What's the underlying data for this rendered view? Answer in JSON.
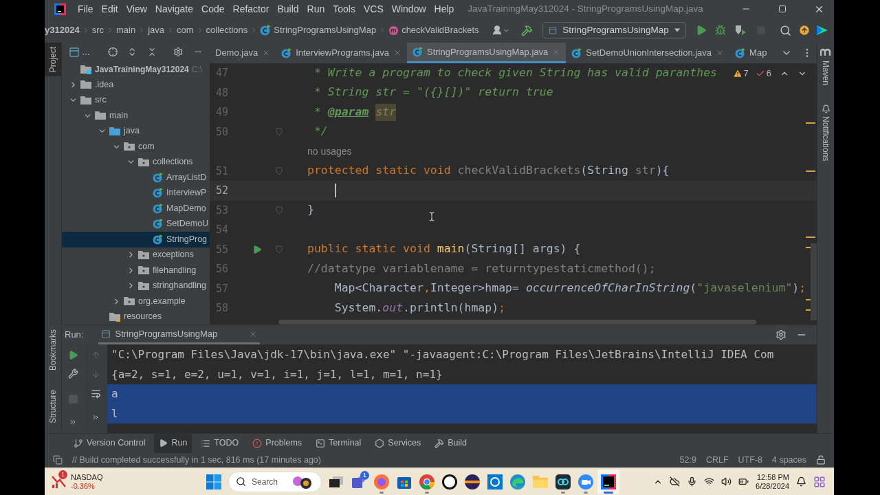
{
  "window": {
    "title": "JavaTrainingMay312024 - StringProgramsUsingMap.java"
  },
  "menu": [
    "File",
    "Edit",
    "View",
    "Navigate",
    "Code",
    "Refactor",
    "Build",
    "Run",
    "Tools",
    "VCS",
    "Window",
    "Help"
  ],
  "breadcrumbs": [
    {
      "label": "y312024",
      "kind": "module"
    },
    {
      "label": "src",
      "kind": "folder"
    },
    {
      "label": "main",
      "kind": "folder"
    },
    {
      "label": "java",
      "kind": "folder"
    },
    {
      "label": "com",
      "kind": "folder"
    },
    {
      "label": "collections",
      "kind": "folder"
    },
    {
      "label": "StringProgramsUsingMap",
      "kind": "class"
    },
    {
      "label": "checkValidBrackets",
      "kind": "method"
    }
  ],
  "toolbar": {
    "run_config": "StringProgramsUsingMap"
  },
  "left_strip": [
    {
      "label": "Project",
      "selected": true
    },
    {
      "label": "Bookmarks",
      "selected": false
    },
    {
      "label": "Structure",
      "selected": false
    }
  ],
  "right_strip": [
    {
      "label": "Maven"
    },
    {
      "label": "Notifications"
    }
  ],
  "project_panel": {
    "view_selector": "…"
  },
  "tree": {
    "label": "JavaTrainingMay312024",
    "path": "C:\\",
    "kind": "module",
    "selected": false,
    "children": [
      {
        "label": ".idea",
        "kind": "folder",
        "expanded": false,
        "selected": false
      },
      {
        "label": "src",
        "kind": "folder",
        "expanded": true,
        "selected": false,
        "children": [
          {
            "label": "main",
            "kind": "folder",
            "expanded": true,
            "selected": false,
            "children": [
              {
                "label": "java",
                "kind": "source",
                "expanded": true,
                "selected": false,
                "children": [
                  {
                    "label": "com",
                    "kind": "package",
                    "expanded": true,
                    "selected": false,
                    "children": [
                      {
                        "label": "collections",
                        "kind": "package",
                        "expanded": true,
                        "selected": false,
                        "children": [
                          {
                            "label": "ArrayListD",
                            "kind": "class",
                            "selected": false
                          },
                          {
                            "label": "InterviewP",
                            "kind": "class",
                            "selected": false
                          },
                          {
                            "label": "MapDemo",
                            "kind": "class",
                            "selected": false
                          },
                          {
                            "label": "SetDemoU",
                            "kind": "class",
                            "selected": false
                          },
                          {
                            "label": "StringProg",
                            "kind": "class",
                            "selected": true
                          }
                        ]
                      },
                      {
                        "label": "exceptions",
                        "kind": "package",
                        "expanded": false,
                        "selected": false
                      },
                      {
                        "label": "filehandling",
                        "kind": "package",
                        "expanded": false,
                        "selected": false
                      },
                      {
                        "label": "stringhandling",
                        "kind": "package",
                        "expanded": false,
                        "selected": false
                      }
                    ]
                  },
                  {
                    "label": "org.example",
                    "kind": "package",
                    "expanded": false,
                    "selected": false
                  }
                ]
              },
              {
                "label": "resources",
                "kind": "resources",
                "selected": false
              }
            ]
          }
        ]
      }
    ]
  },
  "tabs": [
    {
      "label": "Demo.java",
      "icon": false,
      "closable": true,
      "selected": false
    },
    {
      "label": "InterviewPrograms.java",
      "icon": true,
      "closable": true,
      "selected": false
    },
    {
      "label": "StringProgramsUsingMap.java",
      "icon": true,
      "closable": true,
      "selected": true
    },
    {
      "label": "SetDemoUnionIntersection.java",
      "icon": true,
      "closable": true,
      "selected": false
    },
    {
      "label": "Map",
      "icon": true,
      "closable": false,
      "selected": false
    }
  ],
  "inspections": {
    "warnings": "7",
    "typos": "6"
  },
  "code": [
    {
      "number": "47",
      "tokens": [
        {
          "text": " * Write a program to check given String has valid paranthes",
          "kind": "doc"
        }
      ]
    },
    {
      "number": "48",
      "tokens": [
        {
          "text": " * String str = \"({}[])\" return true",
          "kind": "doc"
        }
      ]
    },
    {
      "number": "49",
      "tokens": [
        {
          "text": " * ",
          "kind": "doc"
        },
        {
          "text": "@param",
          "kind": "doctag"
        },
        {
          "text": "str",
          "kind": "docparam"
        }
      ]
    },
    {
      "number": "50",
      "fold": true,
      "tokens": [
        {
          "text": " */",
          "kind": "doc"
        }
      ]
    },
    {
      "kind": "inlay",
      "text": "no usages"
    },
    {
      "number": "51",
      "fold": true,
      "tokens": [
        {
          "text": "protected static void ",
          "kind": "keyword"
        },
        {
          "text": "checkValidBrackets",
          "kind": "unused"
        },
        {
          "text": "(String ",
          "kind": "plain"
        },
        {
          "text": "str",
          "kind": "unused"
        },
        {
          "text": "){",
          "kind": "plain"
        }
      ]
    },
    {
      "number": "52",
      "current": true
    },
    {
      "number": "53",
      "fold": true,
      "tokens": [
        {
          "text": "}",
          "kind": "plain"
        }
      ]
    },
    {
      "number": "54"
    },
    {
      "number": "55",
      "fold": true,
      "runnable": true,
      "tokens": [
        {
          "text": "public static void ",
          "kind": "keyword"
        },
        {
          "text": "main",
          "kind": "decl"
        },
        {
          "text": "(String[] args) {",
          "kind": "plain"
        }
      ]
    },
    {
      "number": "56",
      "tokens": [
        {
          "text": "//datatype variablename = returntypestaticmethod();",
          "kind": "comment"
        }
      ]
    },
    {
      "number": "57",
      "tokens": [
        {
          "text": "    Map<Character",
          "kind": "plain"
        },
        {
          "text": ",",
          "kind": "punct"
        },
        {
          "text": "Integer>hmap= ",
          "kind": "plain"
        },
        {
          "text": "occurrenceOfCharInString",
          "kind": "italic"
        },
        {
          "text": "(",
          "kind": "plain"
        },
        {
          "text": "\"javaselenium\"",
          "kind": "string"
        },
        {
          "text": ")",
          "kind": "plain"
        },
        {
          "text": ";",
          "kind": "punct"
        }
      ]
    },
    {
      "number": "58",
      "tokens": [
        {
          "text": "    System.",
          "kind": "plain"
        },
        {
          "text": "out",
          "kind": "field"
        },
        {
          "text": ".println(hmap)",
          "kind": "plain"
        },
        {
          "text": ";",
          "kind": "punct"
        }
      ]
    }
  ],
  "run_panel": {
    "label": "Run:",
    "tab": "StringProgramsUsingMap",
    "console": [
      {
        "text": "\"C:\\Program Files\\Java\\jdk-17\\bin\\java.exe\" \"-javaagent:C:\\Program Files\\JetBrains\\IntelliJ IDEA Com",
        "selected": false
      },
      {
        "text": "{a=2, s=1, e=2, u=1, v=1, i=1, j=1, l=1, m=1, n=1}",
        "selected": false
      },
      {
        "text": "a",
        "selected": true
      },
      {
        "text": "l",
        "selected": true
      }
    ]
  },
  "tool_windows": [
    {
      "label": "Version Control",
      "kind": "vcs",
      "selected": false
    },
    {
      "label": "Run",
      "kind": "run",
      "selected": true
    },
    {
      "label": "TODO",
      "kind": "todo",
      "selected": false
    },
    {
      "label": "Problems",
      "kind": "problems",
      "selected": false
    },
    {
      "label": "Terminal",
      "kind": "terminal",
      "selected": false
    },
    {
      "label": "Services",
      "kind": "services",
      "selected": false
    },
    {
      "label": "Build",
      "kind": "build",
      "selected": false
    }
  ],
  "status_bar": {
    "message": "// Build completed successfully in 1 sec, 816 ms (17 minutes ago)",
    "position": "52:9",
    "line_ending": "CRLF",
    "encoding": "UTF-8",
    "indent": "4 spaces"
  },
  "taskbar": {
    "stock": {
      "name": "NASDAQ",
      "change": "-0.36%",
      "badge": "1"
    },
    "search_placeholder": "Search",
    "apps": [
      {
        "kind": "start",
        "running": false
      },
      {
        "kind": "search"
      },
      {
        "kind": "taskview",
        "running": false
      },
      {
        "kind": "teams",
        "badge": "1",
        "running": false
      },
      {
        "kind": "firefox",
        "running": true
      },
      {
        "kind": "store",
        "running": false
      },
      {
        "kind": "chrome",
        "running": true
      },
      {
        "kind": "dell",
        "running": false
      },
      {
        "kind": "eclipse",
        "running": false
      },
      {
        "kind": "cortana",
        "running": false
      },
      {
        "kind": "edge",
        "running": false
      },
      {
        "kind": "explorer",
        "running": false
      },
      {
        "kind": "app",
        "running": true
      },
      {
        "kind": "zoom",
        "running": true
      },
      {
        "kind": "intellij",
        "running": true
      }
    ],
    "time": "12:58 PM",
    "date": "6/28/2024"
  }
}
